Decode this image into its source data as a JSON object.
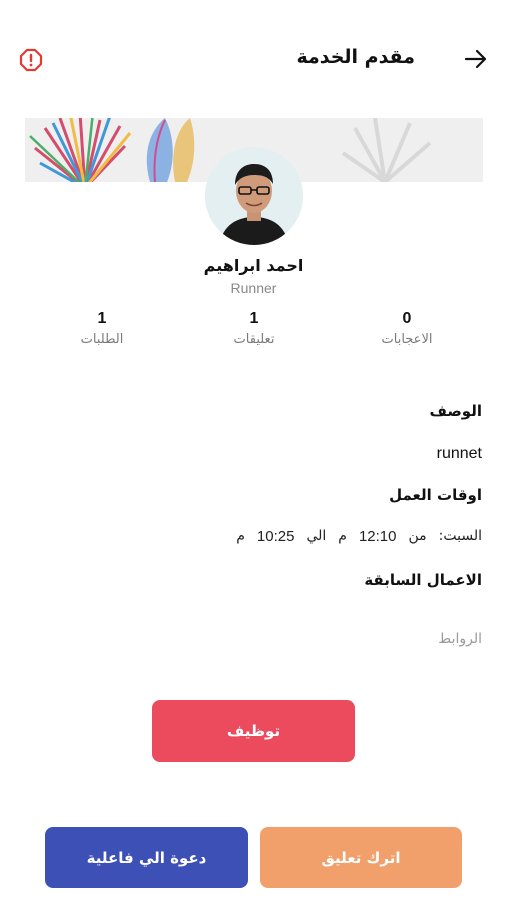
{
  "header": {
    "title": "مقدم الخدمة",
    "back_icon": "arrow-right-icon",
    "report_icon": "alert-octagon-icon"
  },
  "colors": {
    "report": "#e53935",
    "hire": "#ec4a5d",
    "comment": "#f1a06b",
    "invite": "#3d50b6"
  },
  "profile": {
    "name": "احمد ابراهيم",
    "role": "Runner"
  },
  "stats": {
    "likes": {
      "value": "0",
      "label": "الاعجابات"
    },
    "comments": {
      "value": "1",
      "label": "تعليقات"
    },
    "orders": {
      "value": "1",
      "label": "الطلبات"
    }
  },
  "description": {
    "title": "الوصف",
    "text": "runnet"
  },
  "work_hours": {
    "title": "اوقات العمل",
    "day": "السبت:",
    "from_label": "من",
    "from_time": "12:10",
    "from_period": "م",
    "to_label": "الي",
    "to_time": "10:25",
    "to_period": "م"
  },
  "previous_work": {
    "title": "الاعمال السابقة",
    "links_label": "الروابط"
  },
  "buttons": {
    "hire": "توظيف",
    "comment": "اترك تعليق",
    "invite": "دعوة الي فاعلية"
  }
}
